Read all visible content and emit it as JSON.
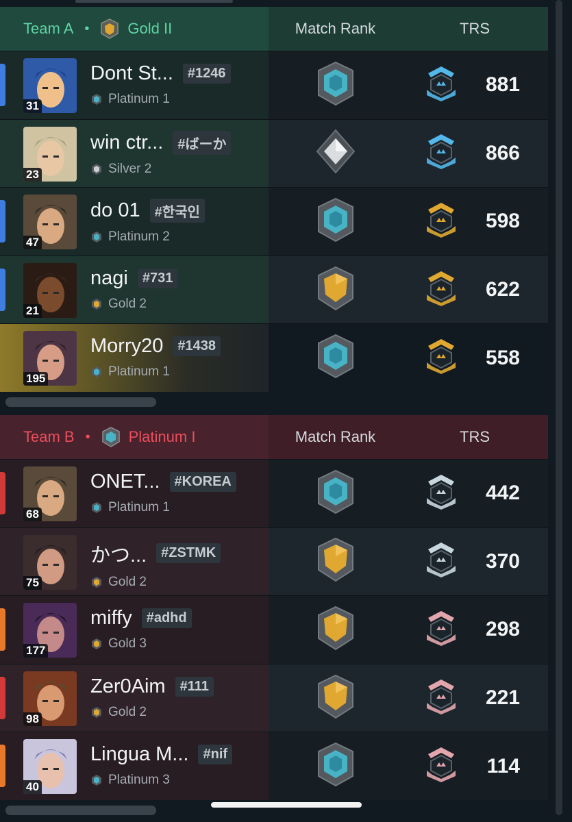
{
  "teamA": {
    "label": "Team A",
    "separator": "•",
    "avg_rank": "Gold II",
    "header_match_rank": "Match Rank",
    "header_trs": "TRS",
    "players": [
      {
        "name": "Dont St...",
        "tag": "#1246",
        "level": "31",
        "rank": "Platinum 1",
        "trs": "881"
      },
      {
        "name": "win ctr...",
        "tag": "#ばーか",
        "level": "23",
        "rank": "Silver 2",
        "trs": "866"
      },
      {
        "name": "do 01",
        "tag": "#한국인",
        "level": "47",
        "rank": "Platinum 2",
        "trs": "598"
      },
      {
        "name": "nagi",
        "tag": "#731",
        "level": "21",
        "rank": "Gold 2",
        "trs": "622"
      },
      {
        "name": "Morry20",
        "tag": "#1438",
        "level": "195",
        "rank": "Platinum 1",
        "trs": "558"
      }
    ]
  },
  "teamB": {
    "label": "Team B",
    "separator": "•",
    "avg_rank": "Platinum I",
    "header_match_rank": "Match Rank",
    "header_trs": "TRS",
    "players": [
      {
        "name": "ONET...",
        "tag": "#KOREA",
        "level": "68",
        "rank": "Platinum 1",
        "trs": "442"
      },
      {
        "name": "かつ...",
        "tag": "#ZSTMK",
        "level": "75",
        "rank": "Gold 2",
        "trs": "370"
      },
      {
        "name": "miffy",
        "tag": "#adhd",
        "level": "177",
        "rank": "Gold 3",
        "trs": "298"
      },
      {
        "name": "Zer0Aim",
        "tag": "#111",
        "level": "98",
        "rank": "Gold 2",
        "trs": "221"
      },
      {
        "name": "Lingua M...",
        "tag": "#nif",
        "level": "40",
        "rank": "Platinum 3",
        "trs": "114"
      }
    ]
  },
  "colors": {
    "teamA_accent": "#5ed4a5",
    "teamB_accent": "#ec4e5c",
    "platinum": "#49b3c6",
    "gold": "#e0a830",
    "silver": "#c9ced2",
    "side_blue": "#3f7ee0",
    "side_red": "#d23a3a",
    "side_orange": "#e8782a"
  }
}
